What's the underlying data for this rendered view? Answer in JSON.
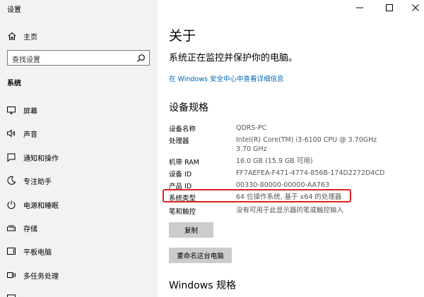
{
  "window": {
    "title": "设置"
  },
  "sidebar": {
    "home_label": "主页",
    "search_placeholder": "查找设置",
    "section_label": "系统",
    "items": [
      {
        "label": "屏幕",
        "icon": "monitor-icon"
      },
      {
        "label": "声音",
        "icon": "speaker-icon"
      },
      {
        "label": "通知和操作",
        "icon": "notification-icon"
      },
      {
        "label": "专注助手",
        "icon": "moon-icon"
      },
      {
        "label": "电源和睡眠",
        "icon": "power-icon"
      },
      {
        "label": "存储",
        "icon": "storage-icon"
      },
      {
        "label": "平板电脑",
        "icon": "tablet-icon"
      },
      {
        "label": "多任务处理",
        "icon": "multitask-icon"
      }
    ]
  },
  "main": {
    "title": "关于",
    "subtitle": "系统正在监控并保护你的电脑。",
    "security_link": "在 Windows 安全中心中查看详细信息",
    "device_specs_heading": "设备规格",
    "specs": [
      {
        "label": "设备名称",
        "value": "QDRS-PC"
      },
      {
        "label": "处理器",
        "value": "Intel(R) Core(TM) i3-6100 CPU @ 3.70GHz   3.70 GHz"
      },
      {
        "label": "机带 RAM",
        "value": "16.0 GB (15.9 GB 可用)"
      },
      {
        "label": "设备 ID",
        "value": "FF7AEFEA-F471-4774-856B-174D2272D4CD"
      },
      {
        "label": "产品 ID",
        "value": "00330-80000-00000-AA763"
      },
      {
        "label": "系统类型",
        "value": "64 位操作系统, 基于 x64 的处理器"
      },
      {
        "label": "笔和触控",
        "value": "没有可用于此显示器的笔或触控输入"
      }
    ],
    "copy_button": "复制",
    "rename_button": "重命名这台电脑",
    "windows_specs_heading": "Windows 规格"
  },
  "colors": {
    "sidebar_bg": "#f2f2f2",
    "link": "#0066b4",
    "highlight": "#e02020",
    "button_bg": "#cccccc"
  }
}
